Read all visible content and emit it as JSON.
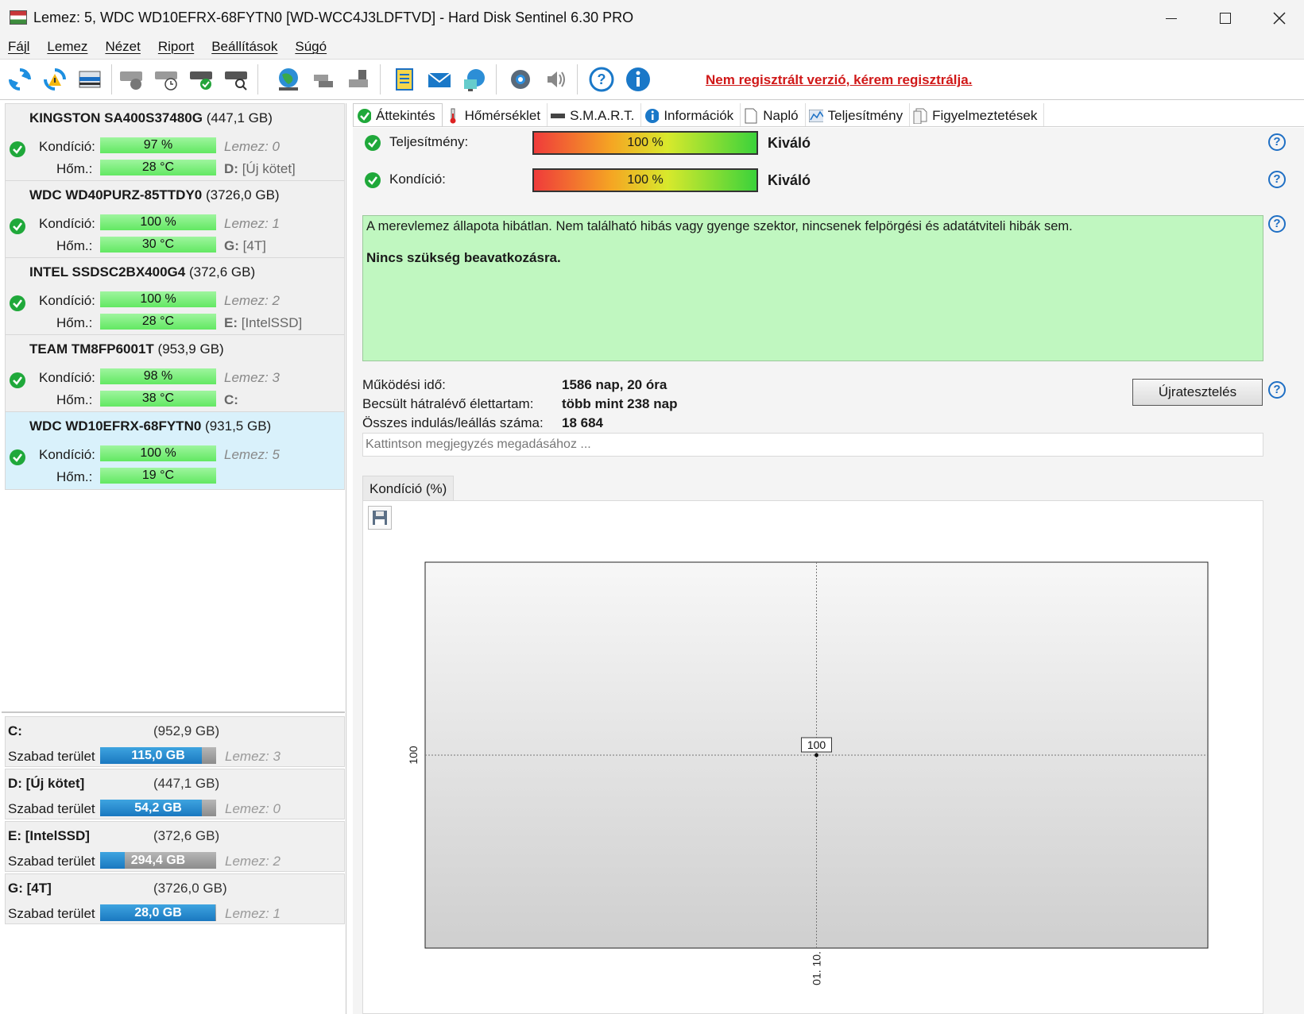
{
  "window": {
    "title": "Lemez: 5, WDC WD10EFRX-68FYTN0 [WD-WCC4J3LDFTVD]  -  Hard Disk Sentinel 6.30 PRO"
  },
  "menu": [
    "Fájl",
    "Lemez",
    "Nézet",
    "Riport",
    "Beállítások",
    "Súgó"
  ],
  "toolbar": {
    "registration_notice": "Nem regisztrált verzió, kérem regisztrálja."
  },
  "disks": [
    {
      "model": "KINGSTON SA400S37480G",
      "size": "(447,1 GB)",
      "health_label": "Kondíció:",
      "health": "97 %",
      "temp_label": "Hőm.:",
      "temp": "28 °C",
      "disk_no": "Lemez: 0",
      "volume_letter": "D:",
      "volume_name": "[Új kötet]"
    },
    {
      "model": "WDC WD40PURZ-85TTDY0",
      "size": "(3726,0 GB)",
      "health_label": "Kondíció:",
      "health": "100 %",
      "temp_label": "Hőm.:",
      "temp": "30 °C",
      "disk_no": "Lemez: 1",
      "volume_letter": "G:",
      "volume_name": "[4T]"
    },
    {
      "model": "INTEL SSDSC2BX400G4",
      "size": "(372,6 GB)",
      "health_label": "Kondíció:",
      "health": "100 %",
      "temp_label": "Hőm.:",
      "temp": "28 °C",
      "disk_no": "Lemez: 2",
      "volume_letter": "E:",
      "volume_name": "[IntelSSD]"
    },
    {
      "model": "TEAM TM8FP6001T",
      "size": "(953,9 GB)",
      "health_label": "Kondíció:",
      "health": "98 %",
      "temp_label": "Hőm.:",
      "temp": "38 °C",
      "disk_no": "Lemez: 3",
      "volume_letter": "C:",
      "volume_name": ""
    },
    {
      "model": "WDC WD10EFRX-68FYTN0",
      "size": "(931,5 GB)",
      "health_label": "Kondíció:",
      "health": "100 %",
      "temp_label": "Hőm.:",
      "temp": "19 °C",
      "disk_no": "Lemez: 5",
      "volume_letter": "",
      "volume_name": ""
    }
  ],
  "volumes": [
    {
      "name": "C:",
      "size": "(952,9 GB)",
      "free_label": "Szabad terület",
      "free": "115,0 GB",
      "used_fraction": 0.88,
      "disk_no": "Lemez: 3"
    },
    {
      "name": "D: [Új kötet]",
      "size": "(447,1 GB)",
      "free_label": "Szabad terület",
      "free": "54,2 GB",
      "used_fraction": 0.88,
      "disk_no": "Lemez: 0"
    },
    {
      "name": "E: [IntelSSD]",
      "size": "(372,6 GB)",
      "free_label": "Szabad terület",
      "free": "294,4 GB",
      "used_fraction": 0.21,
      "disk_no": "Lemez: 2"
    },
    {
      "name": "G: [4T]",
      "size": "(3726,0 GB)",
      "free_label": "Szabad terület",
      "free": "28,0 GB",
      "used_fraction": 0.99,
      "disk_no": "Lemez: 1"
    }
  ],
  "tabs": [
    "Áttekintés",
    "Hőmérséklet",
    "S.M.A.R.T.",
    "Információk",
    "Napló",
    "Teljesítmény",
    "Figyelmeztetések"
  ],
  "overview": {
    "performance": {
      "label": "Teljesítmény:",
      "value": "100 %",
      "rating": "Kiváló"
    },
    "health": {
      "label": "Kondíció:",
      "value": "100 %",
      "rating": "Kiváló"
    },
    "message": "A merevlemez állapota hibátlan. Nem található hibás vagy gyenge szektor, nincsenek felpörgési és adatátviteli hibák sem.",
    "message_bold": "Nincs szükség beavatkozásra.",
    "power_on_label": "Működési idő:",
    "power_on": "1586 nap, 20 óra",
    "lifetime_label": "Becsült hátralévő élettartam:",
    "lifetime": "több mint 238 nap",
    "starts_label": "Összes indulás/leállás száma:",
    "starts": "18 684",
    "retest_button": "Újratesztelés",
    "note_placeholder": "Kattintson megjegyzés megadásához ...",
    "help": "?"
  },
  "chart_tab": "Kondíció  (%)",
  "chart_data": {
    "type": "line",
    "x": [
      "01. 10."
    ],
    "series": [
      {
        "values": [
          100
        ]
      }
    ],
    "ylabel": "",
    "xlabel": "",
    "y_tick_labels": [
      "100"
    ],
    "x_tick_labels": [
      "01. 10."
    ],
    "data_labels": [
      "100"
    ],
    "grid": true
  }
}
